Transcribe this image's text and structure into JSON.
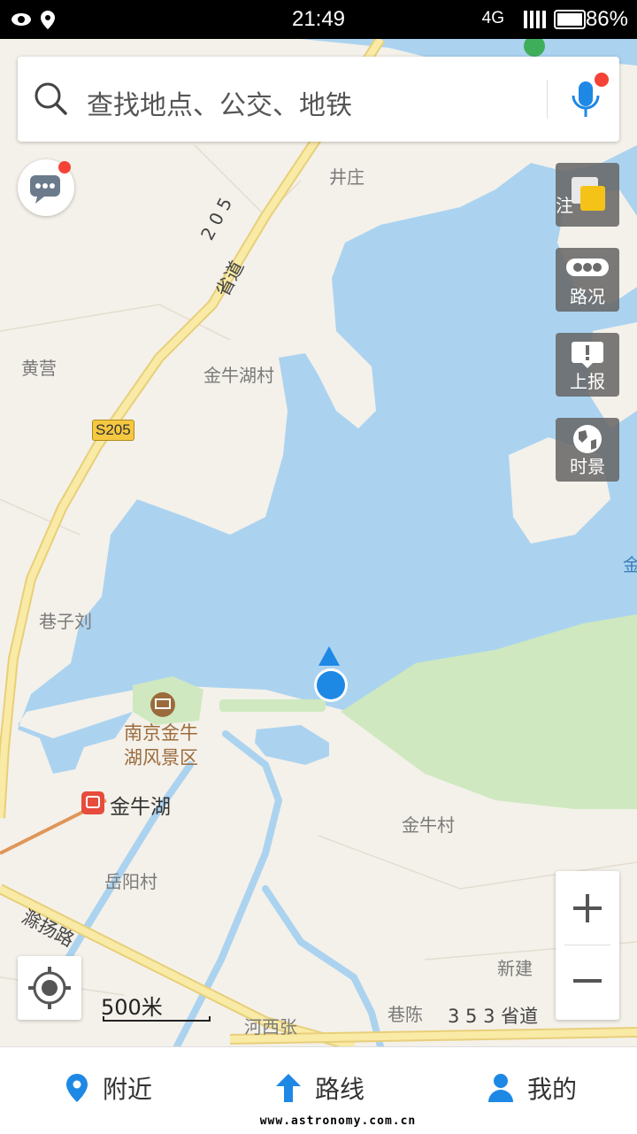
{
  "status_bar": {
    "time": "21:49",
    "network": "4G",
    "battery": "86%"
  },
  "search": {
    "placeholder": "查找地点、公交、地铁"
  },
  "side_buttons": {
    "layers_label": "注",
    "traffic_label": "路况",
    "report_label": "上报",
    "live_label": "时景"
  },
  "map": {
    "labels": {
      "jingzhuang": "井庄",
      "huangying": "黄营",
      "jinniuhu_cun": "金牛湖村",
      "xiangzi_liu": "巷子刘",
      "scenic_line1": "南京金牛",
      "scenic_line2": "湖风景区",
      "metro_station": "金牛湖",
      "jinniu_cun": "金牛村",
      "yueyang_cun": "岳阳村",
      "xinjian": "新建",
      "hexi_zhang": "河西张",
      "xiang_chen": "巷陈",
      "edge_jin": "金",
      "road_205_digits": "2 0 5",
      "road_205_name": "省道",
      "road_shield": "S205",
      "road_chuyang": "滁扬路",
      "road_353": "3 5 3 省道"
    },
    "scale": "500米"
  },
  "nav": {
    "nearby": "附近",
    "route": "路线",
    "mine": "我的"
  },
  "watermark": "www.astronomy.com.cn",
  "colors": {
    "water": "#abd3f0",
    "land": "#f4f1ea",
    "park": "#cfe8c0",
    "road": "#f5e08a",
    "accent_blue": "#1e88e5",
    "badge_red": "#f44336"
  }
}
